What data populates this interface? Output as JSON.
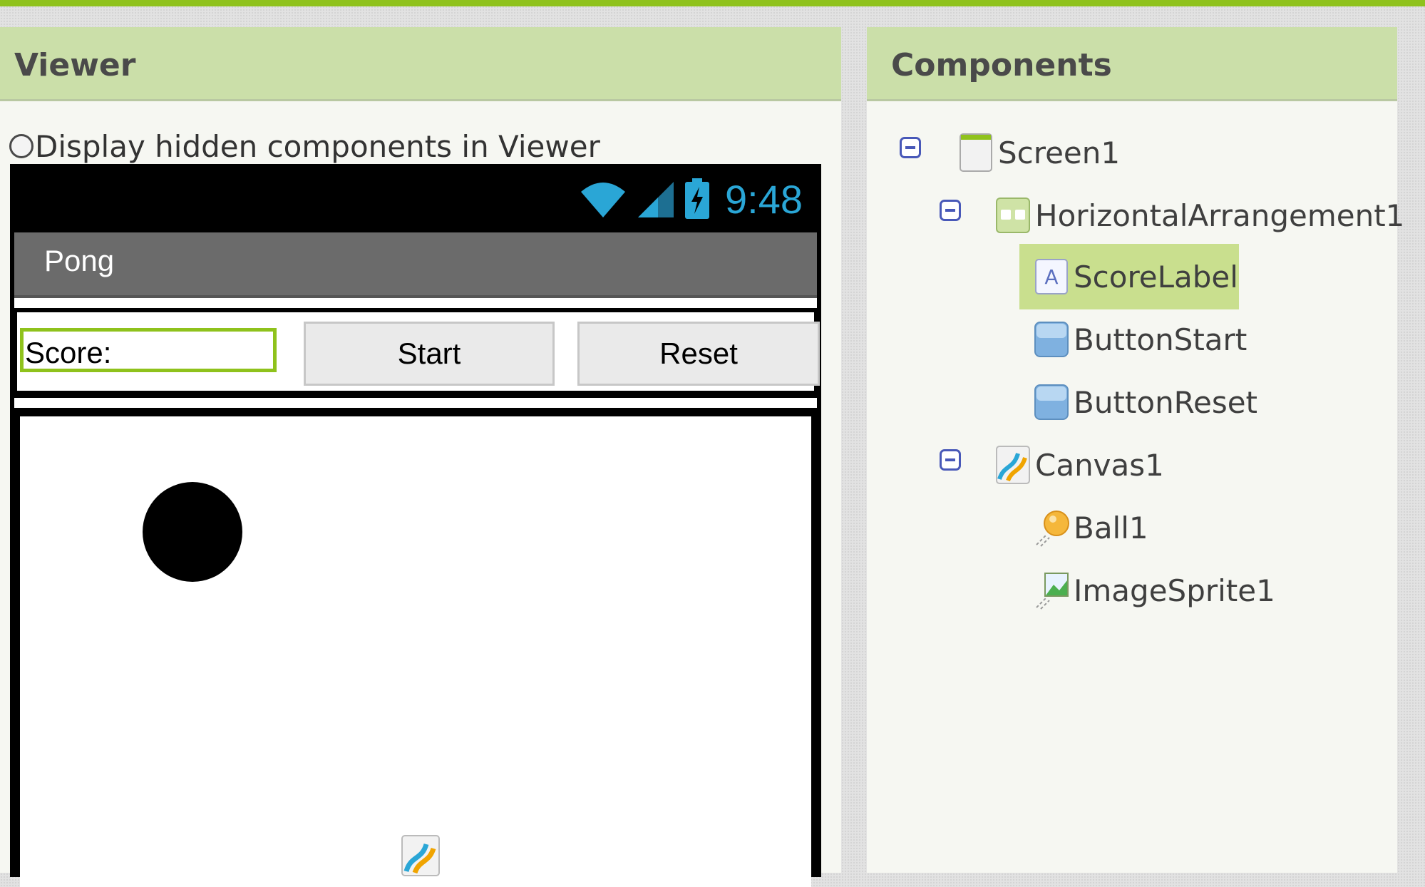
{
  "viewer": {
    "title": "Viewer",
    "hidden_toggle_label": "Display hidden components in Viewer",
    "phone": {
      "clock": "9:48",
      "app_title": "Pong",
      "score_label": "Score:",
      "start_button": "Start",
      "reset_button": "Reset"
    }
  },
  "components": {
    "title": "Components",
    "tree": [
      {
        "label": "Screen1",
        "icon": "screen-icon",
        "collapsible": true
      },
      {
        "label": "HorizontalArrangement1",
        "icon": "horizontal-arrangement-icon",
        "collapsible": true
      },
      {
        "label": "ScoreLabel",
        "icon": "label-icon",
        "selected": true
      },
      {
        "label": "ButtonStart",
        "icon": "button-icon"
      },
      {
        "label": "ButtonReset",
        "icon": "button-icon"
      },
      {
        "label": "Canvas1",
        "icon": "canvas-icon",
        "collapsible": true
      },
      {
        "label": "Ball1",
        "icon": "ball-sprite-icon"
      },
      {
        "label": "ImageSprite1",
        "icon": "image-sprite-icon"
      }
    ]
  },
  "colors": {
    "accent": "#8fc21c",
    "header_bg": "#cbdfa9",
    "selected_bg": "#c9df8e",
    "clock": "#2aa6d6"
  }
}
